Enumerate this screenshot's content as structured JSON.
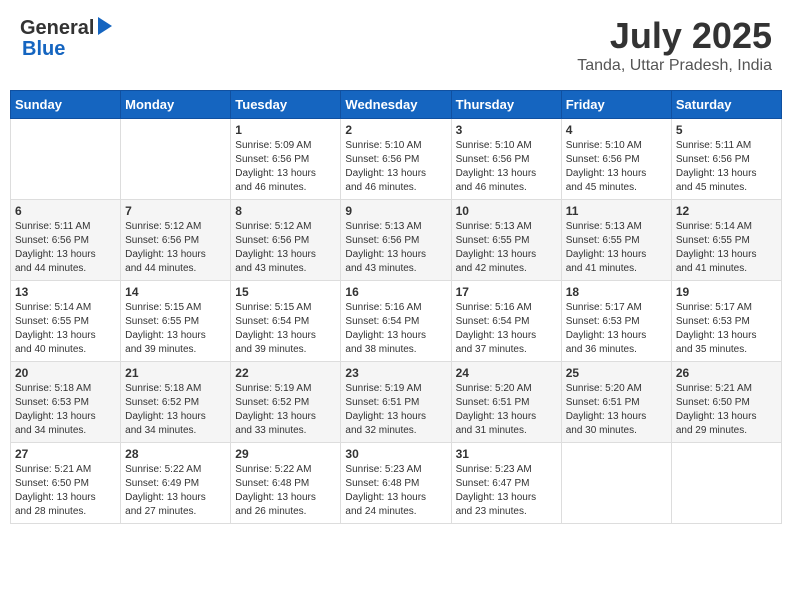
{
  "header": {
    "logo_general": "General",
    "logo_blue": "Blue",
    "main_title": "July 2025",
    "sub_title": "Tanda, Uttar Pradesh, India"
  },
  "calendar": {
    "headers": [
      "Sunday",
      "Monday",
      "Tuesday",
      "Wednesday",
      "Thursday",
      "Friday",
      "Saturday"
    ],
    "weeks": [
      [
        {
          "day": "",
          "info": ""
        },
        {
          "day": "",
          "info": ""
        },
        {
          "day": "1",
          "info": "Sunrise: 5:09 AM\nSunset: 6:56 PM\nDaylight: 13 hours\nand 46 minutes."
        },
        {
          "day": "2",
          "info": "Sunrise: 5:10 AM\nSunset: 6:56 PM\nDaylight: 13 hours\nand 46 minutes."
        },
        {
          "day": "3",
          "info": "Sunrise: 5:10 AM\nSunset: 6:56 PM\nDaylight: 13 hours\nand 46 minutes."
        },
        {
          "day": "4",
          "info": "Sunrise: 5:10 AM\nSunset: 6:56 PM\nDaylight: 13 hours\nand 45 minutes."
        },
        {
          "day": "5",
          "info": "Sunrise: 5:11 AM\nSunset: 6:56 PM\nDaylight: 13 hours\nand 45 minutes."
        }
      ],
      [
        {
          "day": "6",
          "info": "Sunrise: 5:11 AM\nSunset: 6:56 PM\nDaylight: 13 hours\nand 44 minutes."
        },
        {
          "day": "7",
          "info": "Sunrise: 5:12 AM\nSunset: 6:56 PM\nDaylight: 13 hours\nand 44 minutes."
        },
        {
          "day": "8",
          "info": "Sunrise: 5:12 AM\nSunset: 6:56 PM\nDaylight: 13 hours\nand 43 minutes."
        },
        {
          "day": "9",
          "info": "Sunrise: 5:13 AM\nSunset: 6:56 PM\nDaylight: 13 hours\nand 43 minutes."
        },
        {
          "day": "10",
          "info": "Sunrise: 5:13 AM\nSunset: 6:55 PM\nDaylight: 13 hours\nand 42 minutes."
        },
        {
          "day": "11",
          "info": "Sunrise: 5:13 AM\nSunset: 6:55 PM\nDaylight: 13 hours\nand 41 minutes."
        },
        {
          "day": "12",
          "info": "Sunrise: 5:14 AM\nSunset: 6:55 PM\nDaylight: 13 hours\nand 41 minutes."
        }
      ],
      [
        {
          "day": "13",
          "info": "Sunrise: 5:14 AM\nSunset: 6:55 PM\nDaylight: 13 hours\nand 40 minutes."
        },
        {
          "day": "14",
          "info": "Sunrise: 5:15 AM\nSunset: 6:55 PM\nDaylight: 13 hours\nand 39 minutes."
        },
        {
          "day": "15",
          "info": "Sunrise: 5:15 AM\nSunset: 6:54 PM\nDaylight: 13 hours\nand 39 minutes."
        },
        {
          "day": "16",
          "info": "Sunrise: 5:16 AM\nSunset: 6:54 PM\nDaylight: 13 hours\nand 38 minutes."
        },
        {
          "day": "17",
          "info": "Sunrise: 5:16 AM\nSunset: 6:54 PM\nDaylight: 13 hours\nand 37 minutes."
        },
        {
          "day": "18",
          "info": "Sunrise: 5:17 AM\nSunset: 6:53 PM\nDaylight: 13 hours\nand 36 minutes."
        },
        {
          "day": "19",
          "info": "Sunrise: 5:17 AM\nSunset: 6:53 PM\nDaylight: 13 hours\nand 35 minutes."
        }
      ],
      [
        {
          "day": "20",
          "info": "Sunrise: 5:18 AM\nSunset: 6:53 PM\nDaylight: 13 hours\nand 34 minutes."
        },
        {
          "day": "21",
          "info": "Sunrise: 5:18 AM\nSunset: 6:52 PM\nDaylight: 13 hours\nand 34 minutes."
        },
        {
          "day": "22",
          "info": "Sunrise: 5:19 AM\nSunset: 6:52 PM\nDaylight: 13 hours\nand 33 minutes."
        },
        {
          "day": "23",
          "info": "Sunrise: 5:19 AM\nSunset: 6:51 PM\nDaylight: 13 hours\nand 32 minutes."
        },
        {
          "day": "24",
          "info": "Sunrise: 5:20 AM\nSunset: 6:51 PM\nDaylight: 13 hours\nand 31 minutes."
        },
        {
          "day": "25",
          "info": "Sunrise: 5:20 AM\nSunset: 6:51 PM\nDaylight: 13 hours\nand 30 minutes."
        },
        {
          "day": "26",
          "info": "Sunrise: 5:21 AM\nSunset: 6:50 PM\nDaylight: 13 hours\nand 29 minutes."
        }
      ],
      [
        {
          "day": "27",
          "info": "Sunrise: 5:21 AM\nSunset: 6:50 PM\nDaylight: 13 hours\nand 28 minutes."
        },
        {
          "day": "28",
          "info": "Sunrise: 5:22 AM\nSunset: 6:49 PM\nDaylight: 13 hours\nand 27 minutes."
        },
        {
          "day": "29",
          "info": "Sunrise: 5:22 AM\nSunset: 6:48 PM\nDaylight: 13 hours\nand 26 minutes."
        },
        {
          "day": "30",
          "info": "Sunrise: 5:23 AM\nSunset: 6:48 PM\nDaylight: 13 hours\nand 24 minutes."
        },
        {
          "day": "31",
          "info": "Sunrise: 5:23 AM\nSunset: 6:47 PM\nDaylight: 13 hours\nand 23 minutes."
        },
        {
          "day": "",
          "info": ""
        },
        {
          "day": "",
          "info": ""
        }
      ]
    ]
  }
}
